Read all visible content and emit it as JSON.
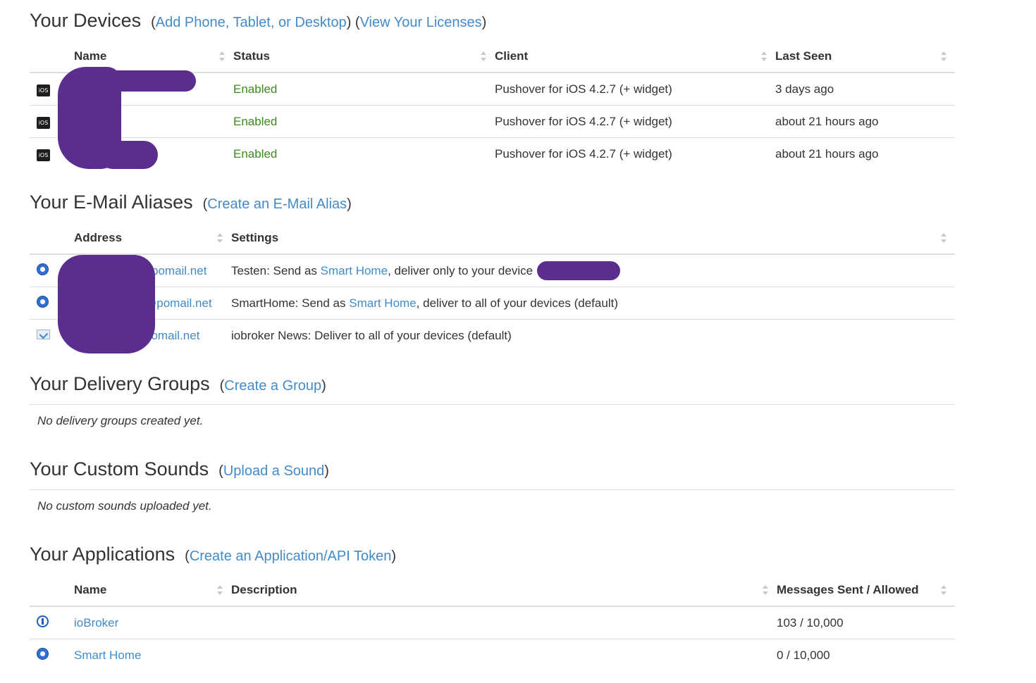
{
  "devices": {
    "title": "Your Devices",
    "links": [
      "Add Phone, Tablet, or Desktop",
      "View Your Licenses"
    ],
    "columns": [
      "Name",
      "Status",
      "Client",
      "Last Seen"
    ],
    "rows": [
      {
        "icon": "ios-icon",
        "icon_text": "iOS",
        "name": "",
        "status": "Enabled",
        "client": "Pushover for iOS 4.2.7 (+ widget)",
        "last_seen": "3 days ago"
      },
      {
        "icon": "ios-icon",
        "icon_text": "iOS",
        "name": "",
        "status": "Enabled",
        "client": "Pushover for iOS 4.2.7 (+ widget)",
        "last_seen": "about 21 hours ago"
      },
      {
        "icon": "ios-icon",
        "icon_text": "iOS",
        "name": "",
        "status": "Enabled",
        "client": "Pushover for iOS 4.2.7 (+ widget)",
        "last_seen": "about 21 hours ago"
      }
    ]
  },
  "aliases": {
    "title": "Your E-Mail Aliases",
    "link": "Create an E-Mail Alias",
    "columns": [
      "Address",
      "Settings"
    ],
    "rows": [
      {
        "icon": "app-round-icon",
        "address": "pomail.net",
        "settings_pre": "Testen: Send as ",
        "settings_link": "Smart Home",
        "settings_post": ", deliver only to your device"
      },
      {
        "icon": "app-round-icon",
        "address": "@pomail.net",
        "settings_pre": "SmartHome: Send as ",
        "settings_link": "Smart Home",
        "settings_post": ", deliver to all of your devices (default)"
      },
      {
        "icon": "mail-check-icon",
        "address": "pomail.net",
        "settings_pre": "iobroker News: Deliver to all of your devices (default)",
        "settings_link": "",
        "settings_post": ""
      }
    ]
  },
  "groups": {
    "title": "Your Delivery Groups",
    "link": "Create a Group",
    "empty": "No delivery groups created yet."
  },
  "sounds": {
    "title": "Your Custom Sounds",
    "link": "Upload a Sound",
    "empty": "No custom sounds uploaded yet."
  },
  "applications": {
    "title": "Your Applications",
    "link": "Create an Application/API Token",
    "columns": [
      "Name",
      "Description",
      "Messages Sent / Allowed"
    ],
    "rows": [
      {
        "icon": "power-icon",
        "name": "ioBroker",
        "description": "",
        "messages": "103 / 10,000"
      },
      {
        "icon": "app-round-icon",
        "name": "Smart Home",
        "description": "",
        "messages": "0 / 10,000"
      }
    ]
  },
  "colors": {
    "link": "#428bca",
    "enabled": "#3c8a1e",
    "redaction": "#5b2d8e"
  }
}
